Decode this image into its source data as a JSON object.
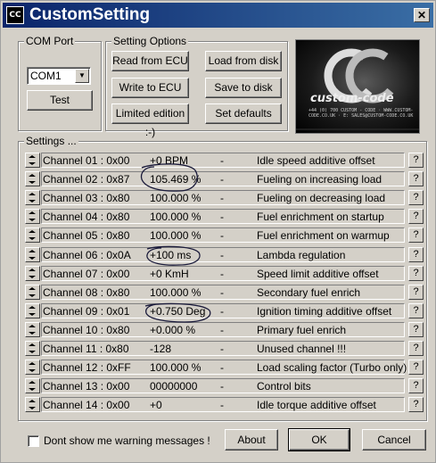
{
  "window": {
    "icon_text": "CC",
    "title": "CustomSetting",
    "close_label": "✕"
  },
  "com_port": {
    "label": "COM Port",
    "selected": "COM1",
    "dropdown_arrow": "▼",
    "test_label": "Test"
  },
  "setting_options": {
    "label": "Setting Options",
    "read_from_ecu": "Read from ECU",
    "load_from_disk": "Load from disk",
    "write_to_ecu": "Write to ECU",
    "save_to_disk": "Save to disk",
    "limited_edition": "Limited edition :-)",
    "set_defaults": "Set defaults"
  },
  "logo": {
    "text": "custom-code",
    "subtext": "+44 (0) 700 CUSTOM - CODE · WWW.CUSTOM-CODE.CO.UK · E: SALES@CUSTOM-CODE.CO.UK"
  },
  "settings": {
    "label": "Settings ...",
    "help_label": "?",
    "rows": [
      {
        "channel": "Channel 01 : 0x00",
        "value": "+0  BPM",
        "dash": "-",
        "desc": "Idle speed additive offset"
      },
      {
        "channel": "Channel 02 : 0x87",
        "value": "105.469 %",
        "dash": "-",
        "desc": "Fueling on increasing load"
      },
      {
        "channel": "Channel 03 : 0x80",
        "value": "100.000 %",
        "dash": "-",
        "desc": "Fueling on decreasing load"
      },
      {
        "channel": "Channel 04 : 0x80",
        "value": "100.000 %",
        "dash": "-",
        "desc": "Fuel enrichment on startup"
      },
      {
        "channel": "Channel 05 : 0x80",
        "value": "100.000 %",
        "dash": "-",
        "desc": "Fuel enrichment on warmup"
      },
      {
        "channel": "Channel 06 : 0x0A",
        "value": "+100  ms",
        "dash": "-",
        "desc": "Lambda regulation"
      },
      {
        "channel": "Channel 07 : 0x00",
        "value": "+0  KmH",
        "dash": "-",
        "desc": "Speed limit additive offset"
      },
      {
        "channel": "Channel 08 : 0x80",
        "value": "100.000 %",
        "dash": "-",
        "desc": "Secondary fuel enrich"
      },
      {
        "channel": "Channel 09 : 0x01",
        "value": "+0.750  Deg",
        "dash": "-",
        "desc": "Ignition timing additive offset"
      },
      {
        "channel": "Channel 10 : 0x80",
        "value": "+0.000 %",
        "dash": "-",
        "desc": "Primary fuel enrich"
      },
      {
        "channel": "Channel 11 : 0x80",
        "value": "-128",
        "dash": "-",
        "desc": "Unused channel !!!"
      },
      {
        "channel": "Channel 12 : 0xFF",
        "value": "100.000 %",
        "dash": "-",
        "desc": "Load scaling factor  (Turbo only)"
      },
      {
        "channel": "Channel 13 : 0x00",
        "value": "00000000",
        "dash": "-",
        "desc": "Control bits"
      },
      {
        "channel": "Channel 14 : 0x00",
        "value": "+0",
        "dash": "-",
        "desc": "Idle torque additive offset"
      }
    ]
  },
  "footer": {
    "dont_show_label": "Dont show me warning messages !",
    "dont_show_checked": false,
    "about_label": "About",
    "ok_label": "OK",
    "cancel_label": "Cancel"
  },
  "colors": {
    "title_bar": "#0a246a",
    "face": "#d4d0c8",
    "annotation_ink": "#1a1a3a"
  }
}
